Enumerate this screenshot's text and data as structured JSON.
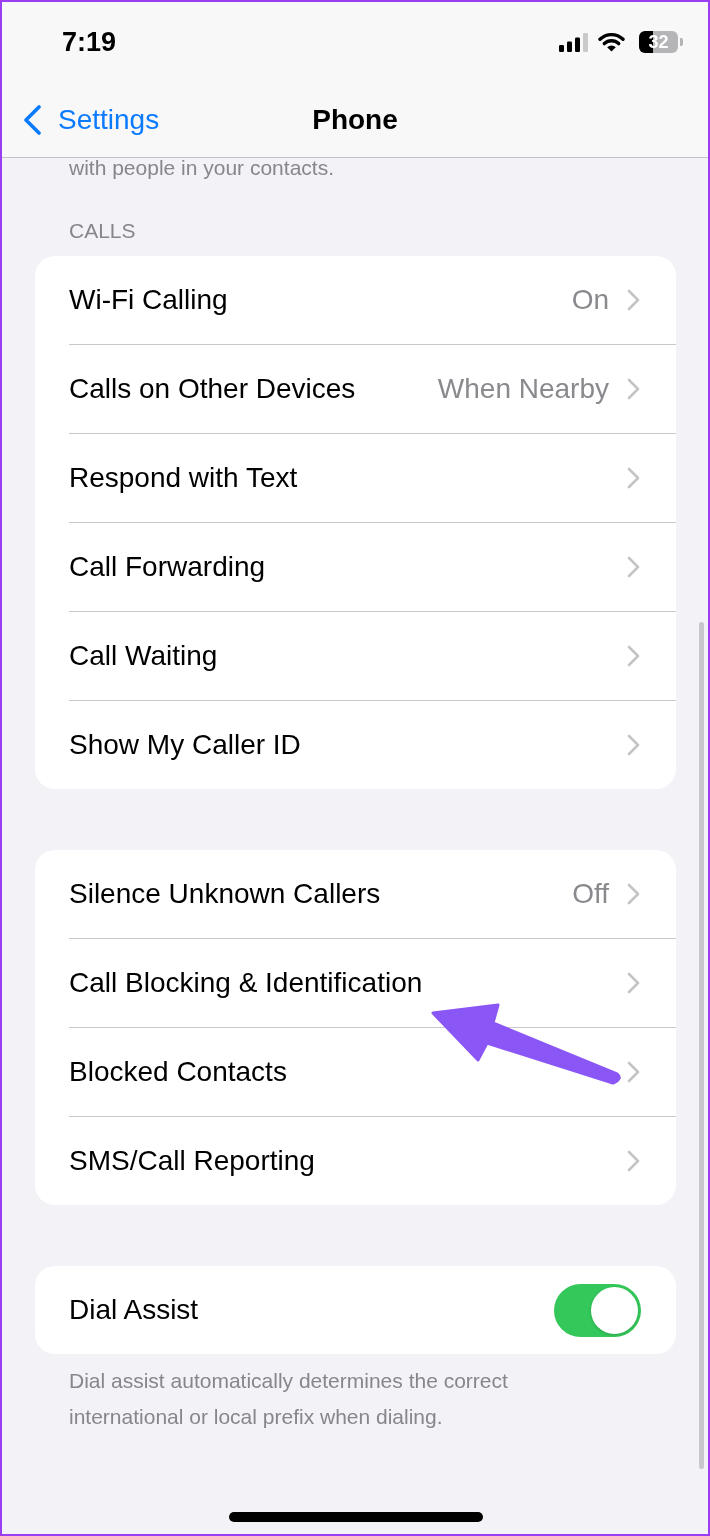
{
  "status_bar": {
    "time": "7:19",
    "battery_percent": "32"
  },
  "nav": {
    "back_label": "Settings",
    "title": "Phone"
  },
  "intro_note": "with people in your contacts.",
  "sections": [
    {
      "header": "CALLS",
      "rows": [
        {
          "kind": "link",
          "label": "Wi-Fi Calling",
          "value": "On"
        },
        {
          "kind": "link",
          "label": "Calls on Other Devices",
          "value": "When Nearby"
        },
        {
          "kind": "link",
          "label": "Respond with Text"
        },
        {
          "kind": "link",
          "label": "Call Forwarding"
        },
        {
          "kind": "link",
          "label": "Call Waiting"
        },
        {
          "kind": "link",
          "label": "Show My Caller ID"
        }
      ]
    },
    {
      "rows": [
        {
          "kind": "link",
          "label": "Silence Unknown Callers",
          "value": "Off"
        },
        {
          "kind": "link",
          "label": "Call Blocking & Identification"
        },
        {
          "kind": "link",
          "label": "Blocked Contacts"
        },
        {
          "kind": "link",
          "label": "SMS/Call Reporting"
        }
      ]
    },
    {
      "rows": [
        {
          "kind": "toggle",
          "label": "Dial Assist",
          "on": true
        }
      ],
      "footer": "Dial assist automatically determines the correct international or local prefix when dialing."
    }
  ],
  "annotations": [
    {
      "kind": "arrow"
    }
  ]
}
